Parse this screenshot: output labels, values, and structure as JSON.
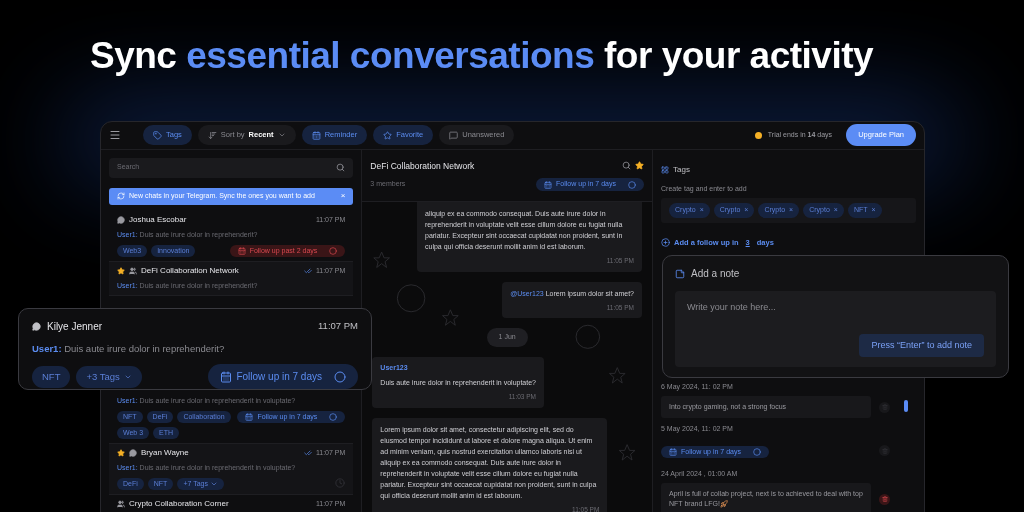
{
  "headline": [
    {
      "text": "Sync",
      "highlight": false
    },
    {
      "text": "essential conversations",
      "highlight": true
    },
    {
      "text": "for your activity",
      "highlight": false
    }
  ],
  "toolbar": {
    "filters": [
      {
        "kind": "tag",
        "label": "Tags",
        "selected": true
      },
      {
        "kind": "sort",
        "label": "Sort by",
        "value": "Recent",
        "selected": false
      },
      {
        "kind": "calendar",
        "label": "Reminder",
        "selected": true
      },
      {
        "kind": "star",
        "label": "Favorite",
        "selected": true
      },
      {
        "kind": "chat",
        "label": "Unanswered",
        "selected": false
      }
    ],
    "trial": "Trial ends in **14** days",
    "upgrade_button": "Upgrade Plan"
  },
  "sidebar": {
    "search": {
      "placeholder": "Search"
    },
    "banner": {
      "text": "New chats in your Telegram. Sync the ones you want to add",
      "close": "×"
    },
    "chats": [
      {
        "name": "Joshua Escobar",
        "kind": "person",
        "starred": false,
        "read": false,
        "time": "11:07 PM",
        "sender": "User1:",
        "preview": "Duis aute irure dolor in reprehenderit?",
        "tags": [
          "Web3",
          "Innovation"
        ],
        "followup": {
          "label": "Follow up past 2 days",
          "overdue": true
        }
      },
      {
        "name": "DeFi Collaboration Network",
        "kind": "group",
        "starred": true,
        "read": true,
        "time": "11:07 PM",
        "sender": "User1:",
        "preview": "Duis aute irure dolor in reprehenderit?"
      },
      {
        "sender": "User1:",
        "preview": "Duis aute irure dolor in reprehenderit in voluptate?",
        "tags": [
          "NFT",
          "DeFi",
          "Collaboration",
          "Web 3",
          "ETH"
        ],
        "followup": {
          "label": "Follow up in 7 days",
          "overdue": false
        }
      },
      {
        "name": "Bryan Wayne",
        "kind": "person",
        "starred": true,
        "read": true,
        "time": "11:07 PM",
        "sender": "User1:",
        "preview": "Duis aute irure dolor in reprehenderit in voluptate?",
        "tags": [
          "DeFi",
          "NFT"
        ],
        "more_tags": "+7 Tags"
      },
      {
        "name": "Crypto Collaboration Corner",
        "kind": "group",
        "starred": false,
        "read": false,
        "time": "11:07 PM"
      }
    ]
  },
  "floating_chat": {
    "name": "Kilye Jenner",
    "time": "11:07 PM",
    "sender": "User1:",
    "preview": "Duis aute irure dolor in reprehenderit?",
    "tags": [
      "NFT"
    ],
    "more_tags": "+3 Tags",
    "followup": "Follow up in 7 days"
  },
  "chat": {
    "title": "DeFi Collaboration Network",
    "members": "3 members",
    "starred": true,
    "followup": "Follow up in 7 days",
    "messages": [
      {
        "kind": "incoming",
        "text": "aliquip ex ea commodo consequat. Duis aute irure dolor in reprehenderit in voluptate velit esse cillum dolore eu fugiat nulla pariatur. Excepteur sint occaecat cupidatat non proident, sunt in culpa qui officia deserunt mollit anim id est laborum.",
        "time": "11:05 PM"
      },
      {
        "kind": "outgoing",
        "mention": "@User123",
        "text": "Lorem ipsum dolor sit amet?",
        "time": "11:05 PM"
      },
      {
        "kind": "date",
        "text": "1 Jun"
      },
      {
        "kind": "incoming",
        "author": "User123",
        "text": "Duis aute irure dolor in reprehenderit in voluptate?",
        "time": "11:03 PM"
      },
      {
        "kind": "incoming",
        "text": "Lorem ipsum dolor sit amet, consectetur adipiscing elit, sed do eiusmod tempor incididunt ut labore et dolore magna aliqua. Ut enim ad minim veniam, quis nostrud exercitation ullamco laboris nisi ut aliquip ex ea commodo consequat. Duis aute irure dolor in reprehenderit in voluptate velit esse cillum dolore eu fugiat nulla pariatur. Excepteur sint occaecat cupidatat non proident, sunt in culpa qui officia deserunt mollit anim id est laborum.",
        "time": "11:05 PM"
      }
    ]
  },
  "details": {
    "tags_title": "Tags",
    "tags_hint": "Create tag and enter to add",
    "tags": [
      "Crypto",
      "Crypto",
      "Crypto",
      "Crypto",
      "NFT"
    ],
    "remove": "×",
    "followup": {
      "prefix": "Add a follow up in",
      "days": "3",
      "suffix": "days"
    },
    "notes": [
      {
        "date": "6 May 2024, 11: 02 PM",
        "kind": "note",
        "text": "Into crypto gaming, not a strong focus",
        "danger": false
      },
      {
        "date": "5 May 2024, 11: 02 PM",
        "kind": "followup",
        "text": "Follow up in 7 days",
        "danger": false
      },
      {
        "date": "24 April 2024 , 01:00 AM",
        "kind": "note",
        "text": "April is full of collab project, next is to achieved to deal with top NFT brand LFG!",
        "danger": true
      }
    ]
  },
  "note_card": {
    "title": "Add a note",
    "placeholder": "Write your note here...",
    "button": "Press “Enter” to add note"
  }
}
